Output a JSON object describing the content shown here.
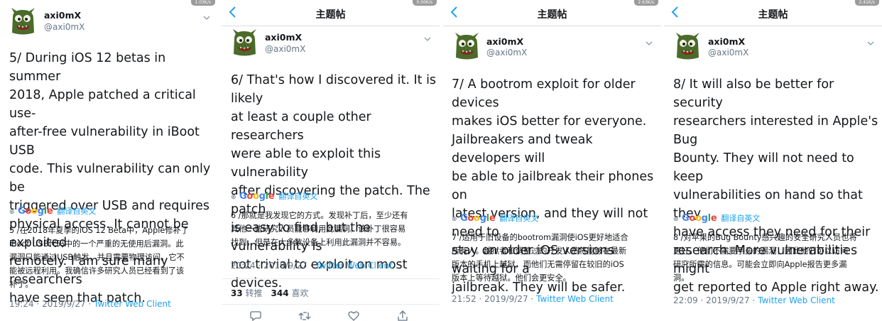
{
  "panels": [
    {
      "speed": "1.03K/s",
      "nav_title": "",
      "user": {
        "name": "axi0mX",
        "handle": "@axi0mX"
      },
      "lines": [
        "5/ During iOS 12 betas in summer",
        "2018, Apple patched a critical use-",
        "after-free vulnerability in iBoot USB",
        "code. This vulnerability can only be",
        "triggered over USB and requires",
        "physical access. It cannot be exploited",
        "remotely. I am sure many researchers",
        "have seen that patch."
      ],
      "translate": "翻译自英文",
      "zh_lines": [
        "5 /在2018年夏季的iOS 12 Beta中，Apple修补了",
        "iBoot USB代码中的一个严重的无使用后漏洞。此",
        "漏洞只能通过USB触发，并且需要物理访问。它不",
        "能被远程利用。我确信许多研究人员已经看到了该",
        "补丁。"
      ],
      "time": "19:24",
      "date": "2019/9/27",
      "client": "Twitter Web Client"
    },
    {
      "speed": "0.00K/s",
      "nav_title": "主题帖",
      "user": {
        "name": "axi0mX",
        "handle": "@axi0mX"
      },
      "lines": [
        "6/ That's how I discovered it. It is likely",
        "at least a couple other researchers",
        "were able to exploit this vulnerability",
        "after discovering the patch. The patch",
        "is easy to find, but the vulnerability is",
        "not trivial to exploit on most devices."
      ],
      "translate": "翻译自英文",
      "zh_lines": [
        "6 /那就是我发现它的方式。发现补丁后，至少还有",
        "其他一些研究人员能够利用此漏洞。该补丁很容易",
        "找到，但是在大多数设备上利用此漏洞并不容易。"
      ],
      "time": "20:24",
      "date": "2019/9/27",
      "client": "Twitter Web Client",
      "retweets": "33",
      "retweets_label": "转推",
      "likes": "344",
      "likes_label": "喜欢"
    },
    {
      "speed": "2.63K/s",
      "nav_title": "主题帖",
      "user": {
        "name": "axi0mX",
        "handle": "@axi0mX"
      },
      "lines": [
        "7/ A bootrom exploit for older devices",
        "makes iOS better for everyone.",
        "Jailbreakers and tweak developers will",
        "be able to jailbreak their phones on",
        "latest version, and they will not need to",
        "stay on older iOS versions waiting for a",
        "jailbreak. They will be safer."
      ],
      "translate": "翻译自英文",
      "zh_lines": [
        "7 /适用于旧设备的bootrom漏洞使iOS更好地适合",
        "所有人。越狱者和调整过的开发人员将能够在最新",
        "版本的手机上越狱，而他们无需停留在较旧的iOS",
        "版本上等待越狱。他们会更安全。"
      ],
      "time": "21:52",
      "date": "2019/9/27",
      "client": "Twitter Web Client"
    },
    {
      "speed": "2.41K/s",
      "nav_title": "主题帖",
      "user": {
        "name": "axi0mX",
        "handle": "@axi0mX"
      },
      "lines": [
        "8/ It will also be better for security",
        "researchers interested in Apple's Bug",
        "Bounty. They will not need to keep",
        "vulnerabilities on hand so that they",
        "have access they need for their",
        "research. More vulnerabilities might",
        "get reported to Apple right away."
      ],
      "translate": "翻译自英文",
      "zh_lines": [
        "8 /对苹果的Bug Bounty感兴趣的安全研究人员也将",
        "更好。他们不需要手头的漏洞，因此他们可以访问",
        "研究所需的信息。可能会立即向Apple报告更多漏",
        "洞。"
      ],
      "time": "22:09",
      "date": "2019/9/27",
      "client": "Twitter Web Client"
    }
  ],
  "meta_sep": "·",
  "google_word": "Google",
  "colors": {
    "link": "#1da1f2",
    "muted": "#657786",
    "text": "#14171a",
    "avatar": "#4a6b2a"
  }
}
